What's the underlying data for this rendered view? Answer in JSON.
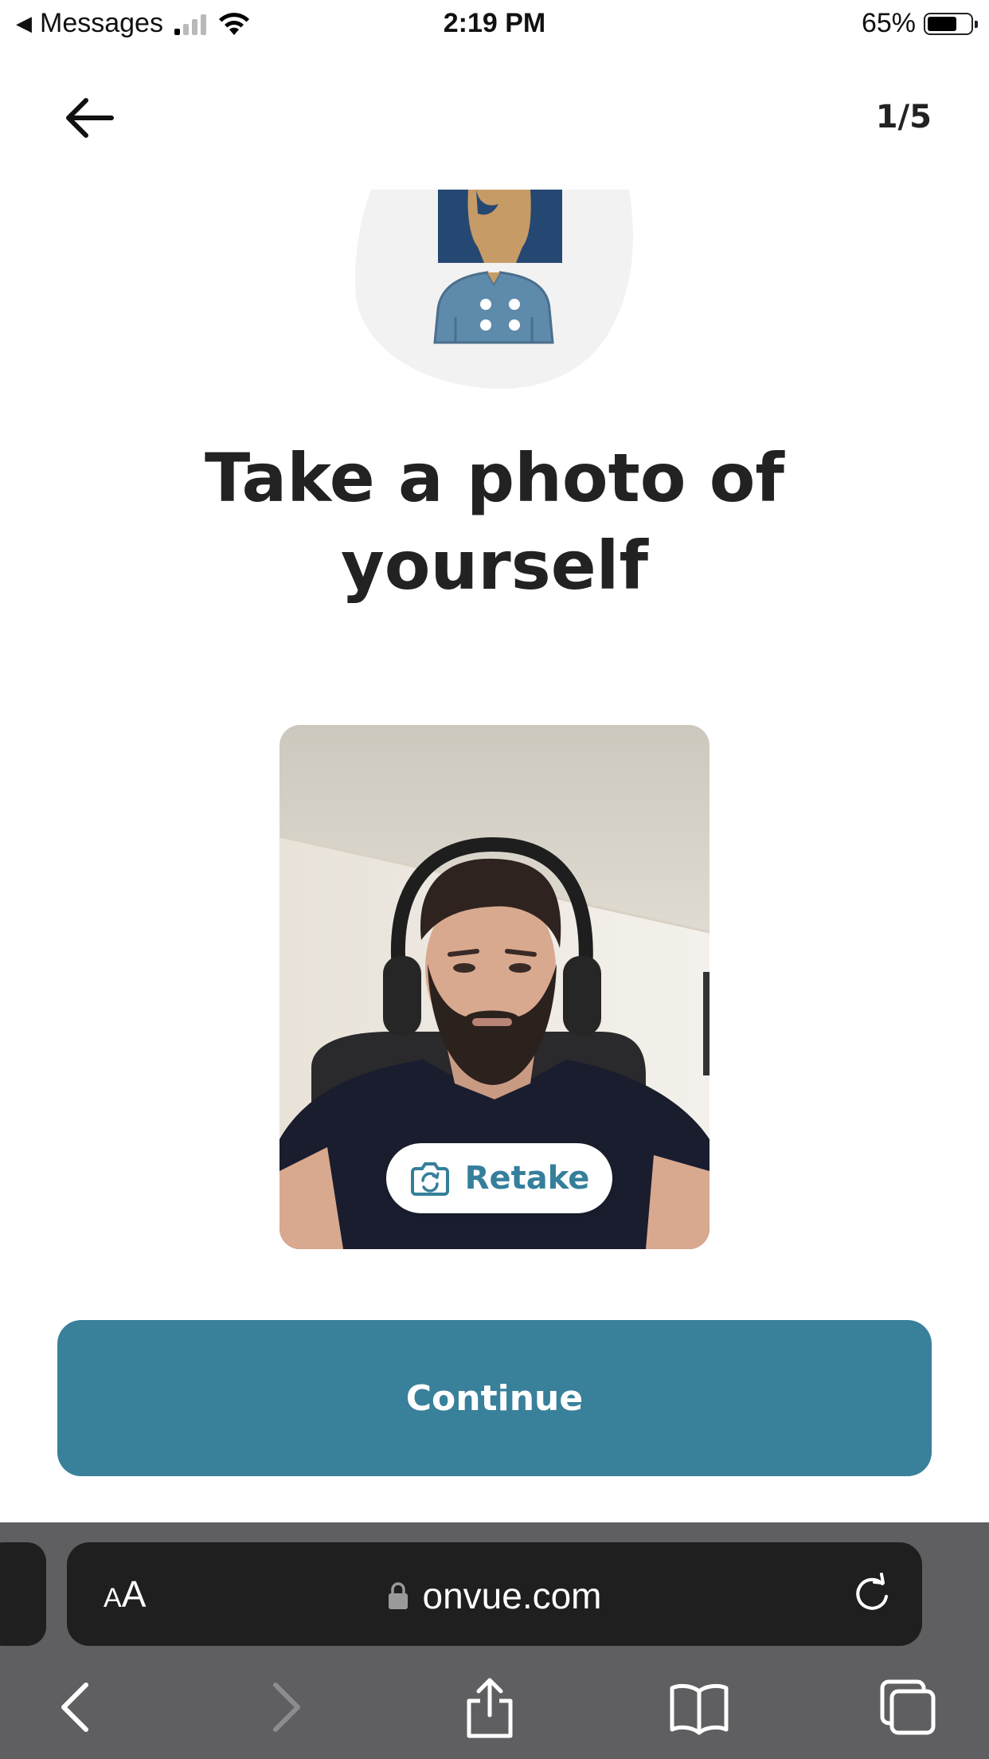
{
  "status_bar": {
    "back_app": "Messages",
    "time": "2:19 PM",
    "battery": "65%",
    "battery_level": 0.65
  },
  "header": {
    "step": "1/5"
  },
  "main": {
    "title": "Take a photo of yourself",
    "retake_label": "Retake",
    "continue_label": "Continue"
  },
  "browser": {
    "text_size_small": "A",
    "text_size_big": "A",
    "url": "onvue.com"
  },
  "colors": {
    "accent": "#39809b",
    "retake_text": "#357f9b"
  },
  "icons": {
    "back": "arrow-left-icon",
    "retake": "camera-rotate-icon",
    "lock": "lock-icon",
    "reload": "reload-icon",
    "share": "share-icon",
    "bookmarks": "book-icon",
    "tabs": "tabs-icon"
  }
}
